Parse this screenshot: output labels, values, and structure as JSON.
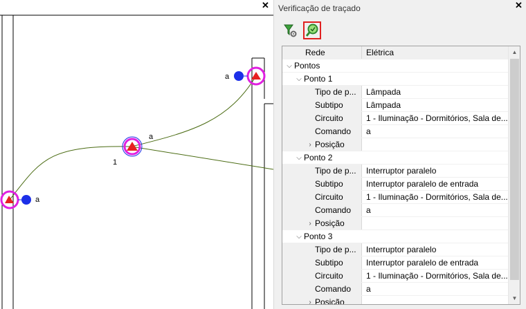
{
  "canvas": {
    "labels": [
      "a",
      "a",
      "1",
      "a"
    ]
  },
  "panel": {
    "title": "Verificação de traçado",
    "toolbar": [
      {
        "name": "filter-settings",
        "icon": "filter-gear-icon"
      },
      {
        "name": "verify",
        "icon": "magnify-check-icon",
        "active": true
      }
    ],
    "grid": {
      "header": {
        "name": "Rede",
        "value": "Elétrica"
      },
      "category": "Pontos",
      "points": [
        {
          "title": "Ponto 1",
          "props": [
            {
              "name": "Tipo de p...",
              "value": "Lâmpada"
            },
            {
              "name": "Subtipo",
              "value": "Lâmpada"
            },
            {
              "name": "Circuito",
              "value": "1 - Iluminação - Dormitórios, Sala de..."
            },
            {
              "name": "Comando",
              "value": "a"
            }
          ],
          "position": "Posição"
        },
        {
          "title": "Ponto 2",
          "props": [
            {
              "name": "Tipo de p...",
              "value": "Interruptor paralelo"
            },
            {
              "name": "Subtipo",
              "value": "Interruptor paralelo de entrada"
            },
            {
              "name": "Circuito",
              "value": "1 - Iluminação - Dormitórios, Sala de..."
            },
            {
              "name": "Comando",
              "value": "a"
            }
          ],
          "position": "Posição"
        },
        {
          "title": "Ponto 3",
          "props": [
            {
              "name": "Tipo de p...",
              "value": "Interruptor paralelo"
            },
            {
              "name": "Subtipo",
              "value": "Interruptor paralelo de entrada"
            },
            {
              "name": "Circuito",
              "value": "1 - Iluminação - Dormitórios, Sala de..."
            },
            {
              "name": "Comando",
              "value": "a"
            }
          ],
          "position": "Posição"
        }
      ]
    }
  },
  "colors": {
    "highlight_ring": "#e020e0",
    "symbol_red": "#e82020",
    "symbol_blue": "#1c2fe8",
    "wire": "#4a6b12",
    "active_border": "#e02020"
  }
}
